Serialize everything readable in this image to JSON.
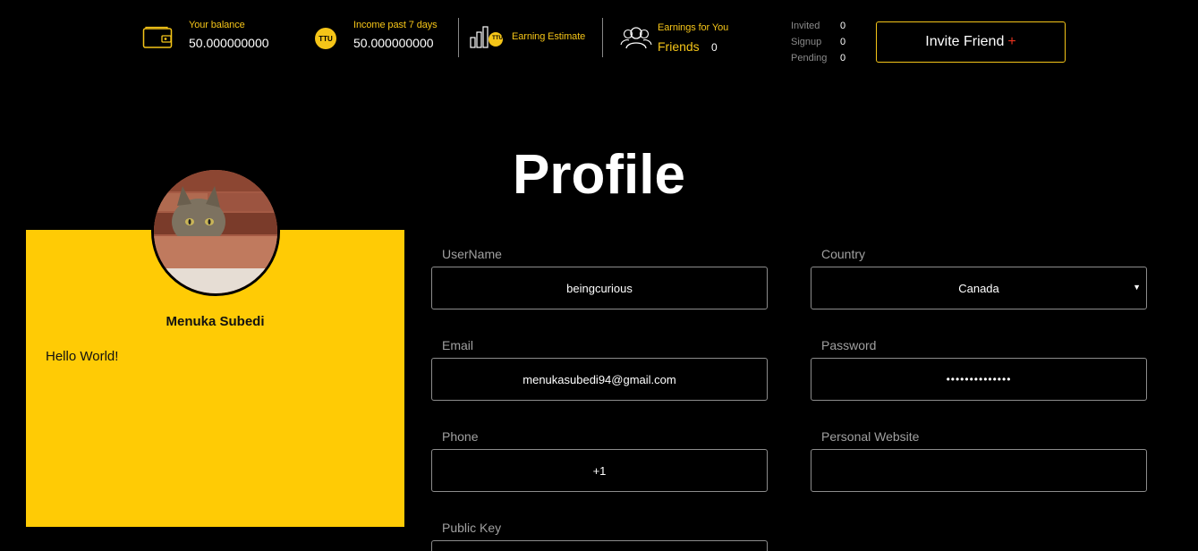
{
  "topbar": {
    "balance": {
      "label": "Your balance",
      "value": "50.000000000"
    },
    "income": {
      "label": "Income past 7 days",
      "value": "50.000000000",
      "coin_text": "TTU"
    },
    "estimate": {
      "label": "Earning Estimate",
      "coin_text": "TTU"
    },
    "earnings": {
      "label": "Earnings for You",
      "friends_label": "Friends",
      "friends_value": "0"
    },
    "invited": {
      "label": "Invited",
      "value": "0"
    },
    "signup": {
      "label": "Signup",
      "value": "0"
    },
    "pending": {
      "label": "Pending",
      "value": "0"
    },
    "invite_button": {
      "label": "Invite Friend",
      "plus": "+"
    }
  },
  "page_title": "Profile",
  "profile_card": {
    "name": "Menuka Subedi",
    "bio": "Hello World!"
  },
  "form": {
    "username": {
      "label": "UserName",
      "value": "beingcurious"
    },
    "country": {
      "label": "Country",
      "value": "Canada"
    },
    "email": {
      "label": "Email",
      "value": "menukasubedi94@gmail.com"
    },
    "password": {
      "label": "Password",
      "value": "••••••••••••••"
    },
    "phone": {
      "label": "Phone",
      "value": "+1"
    },
    "website": {
      "label": "Personal Website",
      "value": ""
    },
    "public_key": {
      "label": "Public Key",
      "value": ""
    }
  },
  "colors": {
    "accent": "#ffcb05",
    "background": "#000000",
    "plus": "#e8321e"
  }
}
